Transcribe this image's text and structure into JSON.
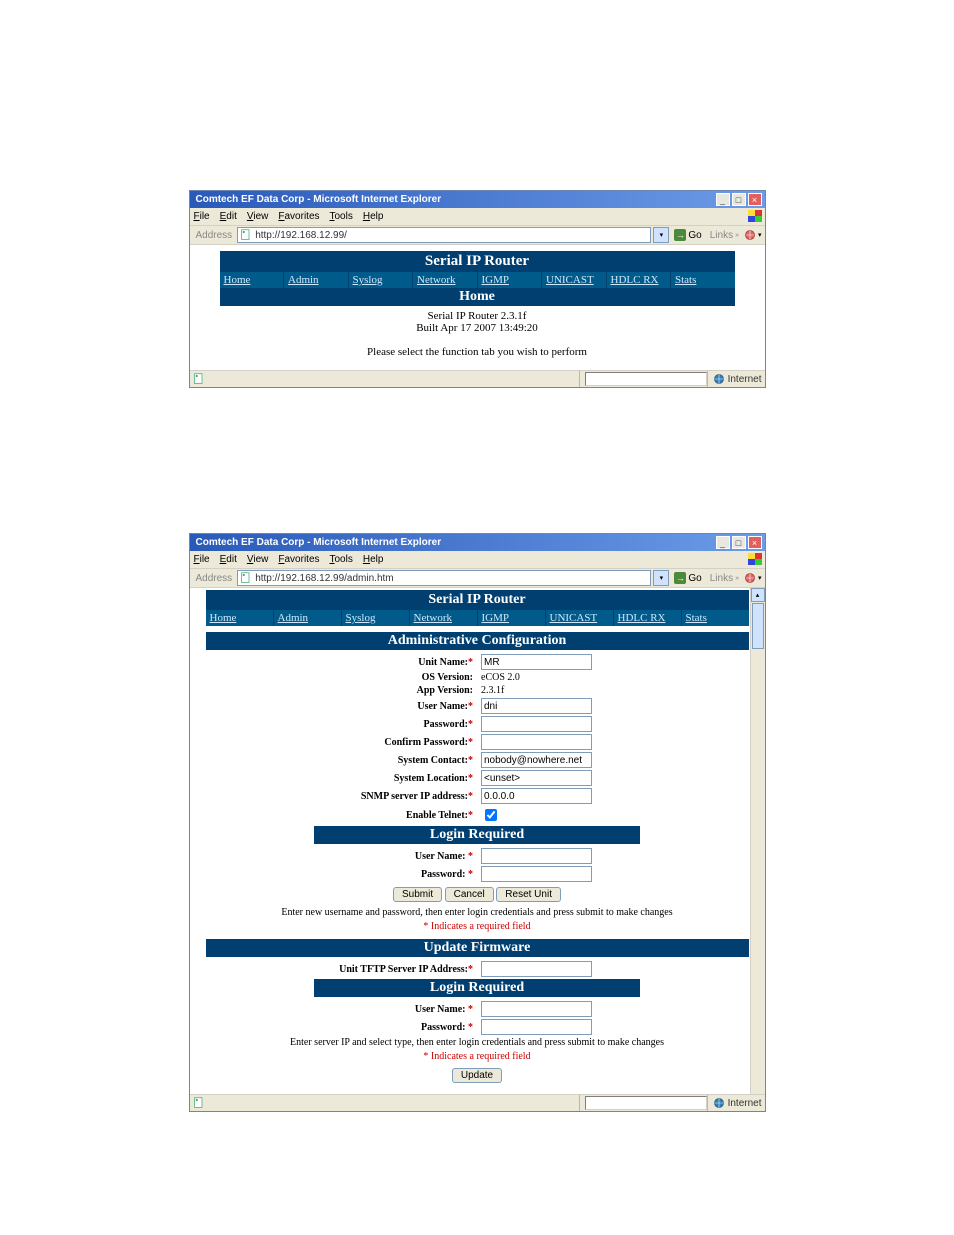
{
  "window1": {
    "title": "Comtech EF Data Corp - Microsoft Internet Explorer",
    "menu": [
      "File",
      "Edit",
      "View",
      "Favorites",
      "Tools",
      "Help"
    ],
    "address_label": "Address",
    "url": "http://192.168.12.99/",
    "go_label": "Go",
    "links_label": "Links",
    "header": "Serial IP Router",
    "tabs": [
      "Home",
      "Admin",
      "Syslog",
      "Network",
      "IGMP",
      "UNICAST",
      "HDLC RX",
      "Stats"
    ],
    "section": "Home",
    "version_line": "Serial IP Router 2.3.1f",
    "build_line": "Built Apr 17 2007 13:49:20",
    "instruction": "Please select the function tab you wish to perform",
    "status_zone": "Internet"
  },
  "window2": {
    "title": "Comtech EF Data Corp - Microsoft Internet Explorer",
    "menu": [
      "File",
      "Edit",
      "View",
      "Favorites",
      "Tools",
      "Help"
    ],
    "address_label": "Address",
    "url": "http://192.168.12.99/admin.htm",
    "go_label": "Go",
    "links_label": "Links",
    "header": "Serial IP Router",
    "tabs": [
      "Home",
      "Admin",
      "Syslog",
      "Network",
      "IGMP",
      "UNICAST",
      "HDLC RX",
      "Stats"
    ],
    "admin_section": "Administrative Configuration",
    "admin": {
      "unit_name_label": "Unit Name:",
      "unit_name_value": "MR",
      "os_version_label": "OS Version:",
      "os_version_value": "eCOS 2.0",
      "app_version_label": "App Version:",
      "app_version_value": "2.3.1f",
      "user_name_label": "User Name:",
      "user_name_value": "dni",
      "password_label": "Password:",
      "confirm_password_label": "Confirm Password:",
      "system_contact_label": "System Contact:",
      "system_contact_value": "nobody@nowhere.net",
      "system_location_label": "System Location:",
      "system_location_value": "<unset>",
      "snmp_ip_label": "SNMP server IP address:",
      "snmp_ip_value": "0.0.0.0",
      "enable_telnet_label": "Enable Telnet:"
    },
    "login_band": "Login Required",
    "login1": {
      "user_name_label": "User Name:",
      "password_label": "Password:",
      "submit": "Submit",
      "cancel": "Cancel",
      "reset": "Reset Unit",
      "note": "Enter new username and password, then enter login credentials and press submit to make changes"
    },
    "required_note": "* Indicates a required field",
    "firmware_section": "Update Firmware",
    "firmware": {
      "tftp_label": "Unit TFTP Server IP Address:"
    },
    "login2": {
      "user_name_label": "User Name:",
      "password_label": "Password:",
      "note": "Enter server IP and select type, then enter login credentials and press submit to make changes"
    },
    "update_btn": "Update",
    "status_zone": "Internet"
  }
}
